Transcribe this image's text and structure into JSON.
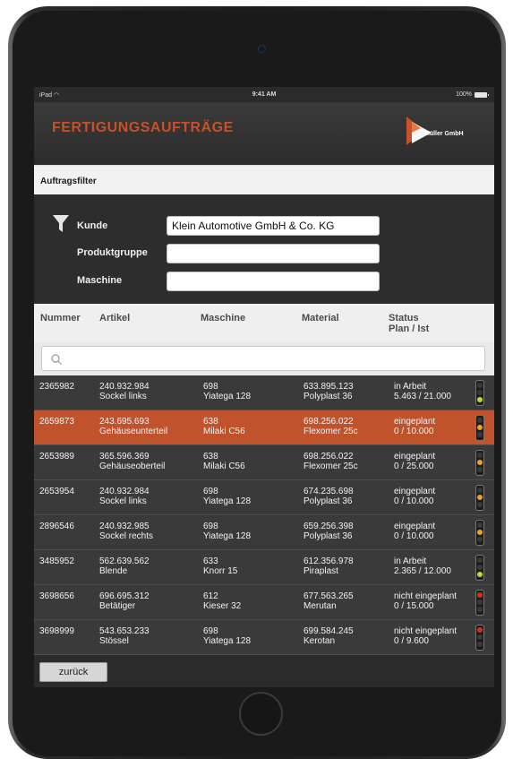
{
  "statusbar": {
    "carrier": "iPad",
    "time": "9:41 AM",
    "battery": "100%"
  },
  "header": {
    "title": "FERTIGUNGSAUFTRÄGE",
    "company": "Müller GmbH",
    "accent": "#c8502a"
  },
  "filter": {
    "title": "Auftragsfilter",
    "customer_label": "Kunde",
    "customer_value": "Klein Automotive GmbH & Co. KG",
    "product_group_label": "Produktgruppe",
    "product_group_value": "",
    "machine_label": "Maschine",
    "machine_value": ""
  },
  "table": {
    "headers": {
      "number": "Nummer",
      "article": "Artikel",
      "machine": "Maschine",
      "material": "Material",
      "status": "Status",
      "status_sub": "Plan / Ist"
    },
    "search_placeholder": "",
    "rows": [
      {
        "number": "2365982",
        "article_no": "240.932.984",
        "article_name": "Sockel links",
        "machine_no": "698",
        "machine_name": "Yiatega 128",
        "material_no": "633.895.123",
        "material_name": "Polyplast 36",
        "status": "in Arbeit",
        "plan_ist": "5.463 / 21.000",
        "light": "green",
        "selected": false
      },
      {
        "number": "2659873",
        "article_no": "243.695.693",
        "article_name": "Gehäuseunterteil",
        "machine_no": "638",
        "machine_name": "Milaki C56",
        "material_no": "698.256.022",
        "material_name": "Flexomer 25c",
        "status": "eingeplant",
        "plan_ist": "0 / 10.000",
        "light": "yellow",
        "selected": true
      },
      {
        "number": "2653989",
        "article_no": "365.596.369",
        "article_name": "Gehäuseoberteil",
        "machine_no": "638",
        "machine_name": "Milaki C56",
        "material_no": "698.256.022",
        "material_name": "Flexomer 25c",
        "status": "eingeplant",
        "plan_ist": "0 / 25.000",
        "light": "yellow",
        "selected": false
      },
      {
        "number": "2653954",
        "article_no": "240.932.984",
        "article_name": "Sockel links",
        "machine_no": "698",
        "machine_name": "Yiatega 128",
        "material_no": "674.235.698",
        "material_name": "Polyplast 36",
        "status": "eingeplant",
        "plan_ist": "0 / 10.000",
        "light": "yellow",
        "selected": false
      },
      {
        "number": "2896546",
        "article_no": "240.932.985",
        "article_name": "Sockel rechts",
        "machine_no": "698",
        "machine_name": "Yiatega 128",
        "material_no": "659.256.398",
        "material_name": "Polyplast 36",
        "status": "eingeplant",
        "plan_ist": "0 / 10.000",
        "light": "yellow",
        "selected": false
      },
      {
        "number": "3485952",
        "article_no": "562.639.562",
        "article_name": "Blende",
        "machine_no": "633",
        "machine_name": "Knorr 15",
        "material_no": "612.356.978",
        "material_name": "Piraplast",
        "status": "in Arbeit",
        "plan_ist": "2.365 / 12.000",
        "light": "green",
        "selected": false
      },
      {
        "number": "3698656",
        "article_no": "696.695.312",
        "article_name": "Betätiger",
        "machine_no": "612",
        "machine_name": "Kieser 32",
        "material_no": "677.563.265",
        "material_name": "Merutan",
        "status": "nicht eingeplant",
        "plan_ist": "0 / 15.000",
        "light": "red",
        "selected": false
      },
      {
        "number": "3698999",
        "article_no": "543.653.233",
        "article_name": "Stössel",
        "machine_no": "698",
        "machine_name": "Yiatega 128",
        "material_no": "699.584.245",
        "material_name": "Kerotan",
        "status": "nicht eingeplant",
        "plan_ist": "0 / 9.600",
        "light": "red",
        "selected": false
      }
    ]
  },
  "footer": {
    "back_label": "zurück"
  }
}
